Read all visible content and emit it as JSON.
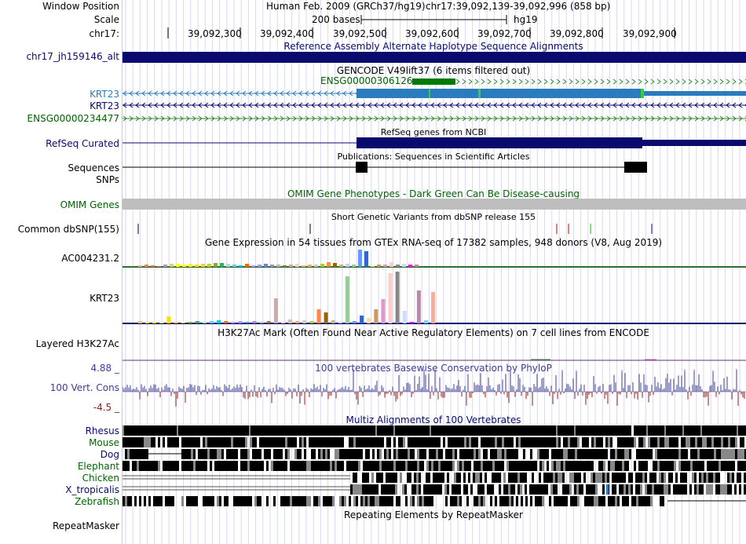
{
  "header": {
    "window_position_label": "Window Position",
    "assembly": "Human Feb. 2009 (GRCh37/hg19)",
    "position": "chr17:39,092,139-39,092,996 (858 bp)",
    "scale_label": "Scale",
    "scale_bar_text": "200 bases",
    "db": "hg19",
    "chrom_label": "chr17:",
    "ruler_ticks": [
      "39,092,300",
      "39,092,400",
      "39,092,500",
      "39,092,600",
      "39,092,700",
      "39,092,800",
      "39,092,900"
    ]
  },
  "tracks": {
    "alt_hap": {
      "label": "chr17_jh159146_alt",
      "title": "Reference Assembly Alternate Haplotype Sequence Alignments",
      "color": "#0a0a6e"
    },
    "gencode": {
      "title": "GENCODE V49lift37 (6 items filtered out)",
      "items": [
        {
          "label": "ENSG00000306126",
          "color": "#006400"
        },
        {
          "label": "KRT23",
          "color": "#2b7bbf"
        },
        {
          "label": "KRT23",
          "color": "#0a0a6e"
        },
        {
          "label": "ENSG00000234477",
          "color": "#006400"
        }
      ]
    },
    "refseq": {
      "label": "RefSeq Curated",
      "title": "RefSeq genes from NCBI",
      "color": "#0a0a6e"
    },
    "publications": {
      "label": "Sequences",
      "title": "Publications: Sequences in Scientific Articles"
    },
    "snps": {
      "label": "SNPs"
    },
    "omim": {
      "label": "OMIM Genes",
      "title": "OMIM Gene Phenotypes - Dark Green Can Be Disease-causing",
      "color": "#006400"
    },
    "dbsnp": {
      "label": "Common dbSNP(155)",
      "title": "Short Genetic Variants from dbSNP release 155"
    },
    "gtex": {
      "title": "Gene Expression in 54 tissues from GTEx RNA-seq of 17382 samples, 948 donors (V8, Aug 2019)",
      "genes": [
        "AC004231.2",
        "KRT23"
      ]
    },
    "h3k27ac": {
      "label": "Layered H3K27Ac",
      "title": "H3K27Ac Mark (Often Found Near Active Regulatory Elements) on 7 cell lines from ENCODE"
    },
    "phylop": {
      "label": "100 Vert. Cons",
      "title": "100 vertebrates Basewise Conservation by PhyloP",
      "max": "4.88 _",
      "min": "-4.5 _",
      "color": "#3c3c96"
    },
    "multiz": {
      "title": "Multiz Alignments of 100 Vertebrates",
      "species": [
        {
          "label": "Rhesus",
          "color": "#0a0a6e"
        },
        {
          "label": "Mouse",
          "color": "#006400"
        },
        {
          "label": "Dog",
          "color": "#0a0a6e"
        },
        {
          "label": "Elephant",
          "color": "#006400"
        },
        {
          "label": "Chicken",
          "color": "#006400"
        },
        {
          "label": "X_tropicalis",
          "color": "#0a0a6e"
        },
        {
          "label": "Zebrafish",
          "color": "#006400"
        }
      ]
    },
    "repeatmasker": {
      "label": "RepeatMasker",
      "title": "Repeating Elements by RepeatMasker"
    }
  }
}
